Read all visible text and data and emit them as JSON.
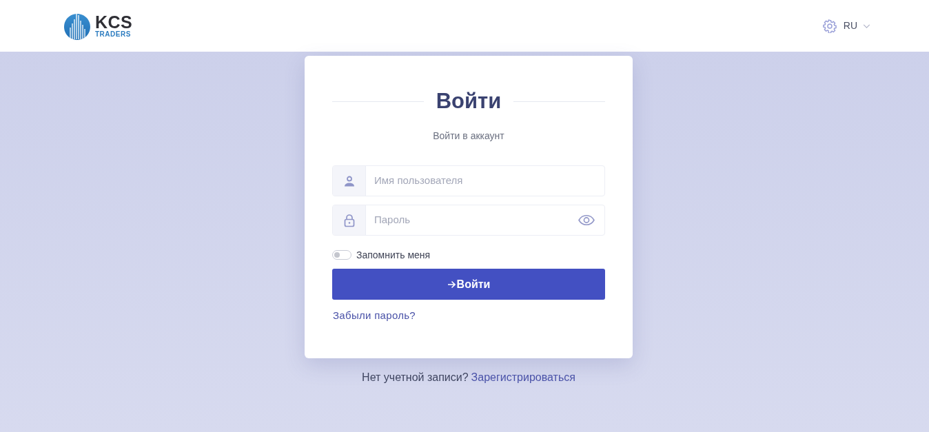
{
  "header": {
    "logo": {
      "name": "KCS",
      "tagline": "TRADERS"
    },
    "language": {
      "label": "RU"
    }
  },
  "login_card": {
    "title": "Войти",
    "subtitle": "Войти в аккаунт",
    "fields": [
      {
        "kind": "text",
        "placeholder": "Имя пользователя"
      },
      {
        "kind": "password",
        "placeholder": "Пароль"
      }
    ],
    "remember": {
      "label": "Запомнить меня",
      "on": false
    },
    "submit": {
      "label": "Войти"
    },
    "forgot_link": "Забыли пароль?"
  },
  "footer": {
    "prompt": "Нет учетной записи?",
    "link": "Зарегистрироваться"
  }
}
